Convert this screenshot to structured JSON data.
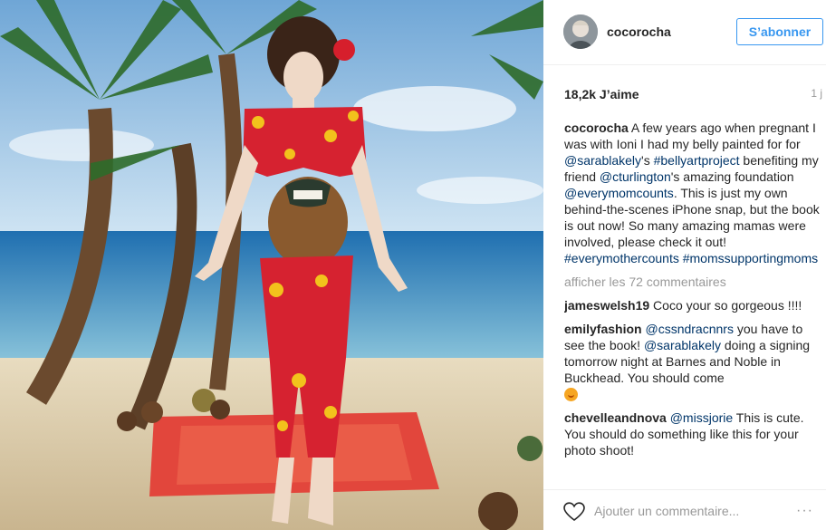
{
  "post": {
    "username": "cocorocha",
    "follow_label": "S’abonner",
    "likes": "18,2k J’aime",
    "time_ago": "1 j",
    "caption": {
      "author": "cocorocha",
      "text1": " A few years ago when pregnant I was with Ioni I had my belly painted for for ",
      "mention1": "@sarablakely",
      "text2": "'s ",
      "hashtag1": "#bellyartproject",
      "text3": " benefiting my friend ",
      "mention2": "@cturlington",
      "text4": "'s amazing foundation ",
      "mention3": "@everymomcounts",
      "text5": ". This is just my own behind-the-scenes iPhone snap, but the book is out now! So many amazing mamas were involved, please check it out! ",
      "hashtag2": "#everymothercounts",
      "hashtag3": "#momssupportingmoms"
    },
    "view_all": "afficher les 72 commentaires",
    "comments": [
      {
        "author": "jameswelsh19",
        "text": " Coco your so gorgeous !!!!"
      },
      {
        "author": "emilyfashion",
        "mention1": "@cssndracnnrs",
        "text1": " you have to see the book! ",
        "mention2": "@sarablakely",
        "text2": " doing a signing tomorrow night at Barnes and Noble in Buckhead. You should come"
      },
      {
        "author": "chevelleandnova",
        "mention1": "@missjorie",
        "text1": " This is cute. You should do something like this for your photo shoot!"
      }
    ],
    "add_comment_placeholder": "Ajouter un commentaire...",
    "more_icon": "···"
  },
  "icons": {
    "heart": "heart-outline-icon",
    "more": "more-options-icon"
  },
  "colors": {
    "link": "#003569",
    "follow": "#3897f0",
    "muted": "#999999"
  }
}
